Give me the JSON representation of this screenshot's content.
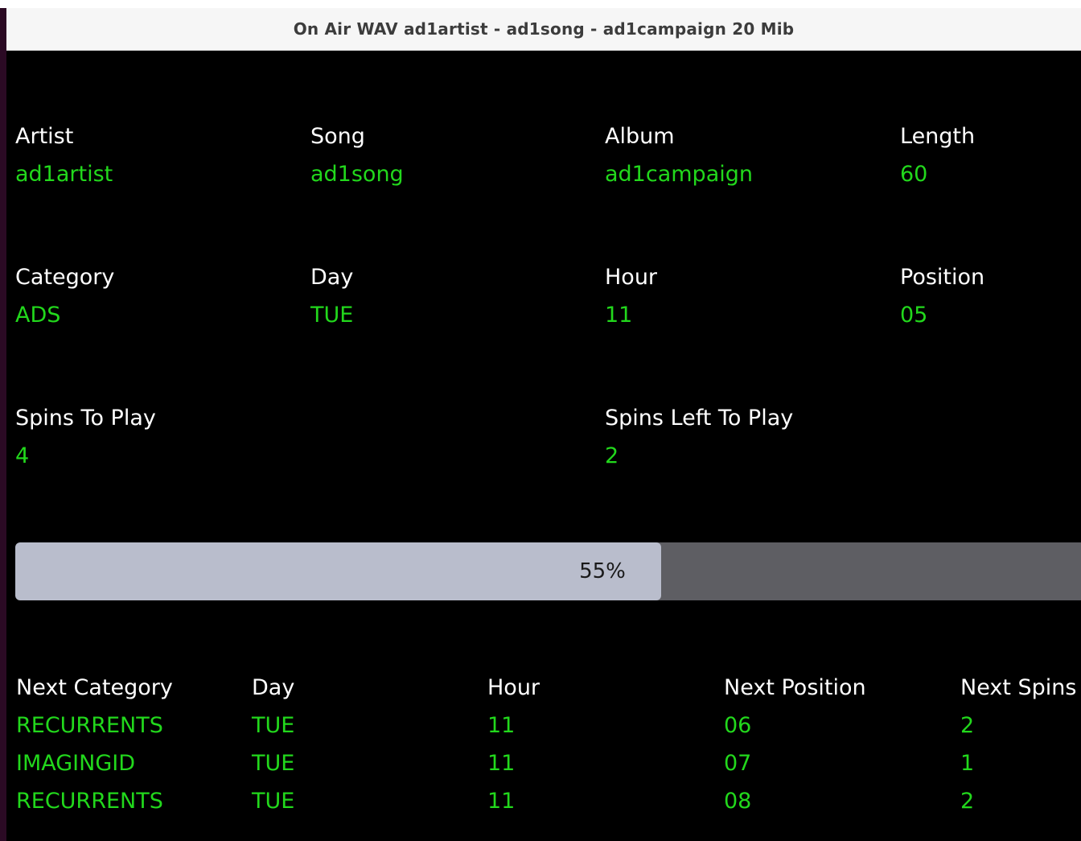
{
  "window": {
    "title": "On Air WAV ad1artist - ad1song - ad1campaign 20 Mib"
  },
  "now_playing": {
    "artist": {
      "label": "Artist",
      "value": "ad1artist"
    },
    "song": {
      "label": "Song",
      "value": "ad1song"
    },
    "album": {
      "label": "Album",
      "value": "ad1campaign"
    },
    "length": {
      "label": "Length",
      "value": "60"
    },
    "category": {
      "label": "Category",
      "value": "ADS"
    },
    "day": {
      "label": "Day",
      "value": "TUE"
    },
    "hour": {
      "label": "Hour",
      "value": "11"
    },
    "position": {
      "label": "Position",
      "value": "05"
    },
    "spins_to_play": {
      "label": "Spins To Play",
      "value": "4"
    },
    "spins_left": {
      "label": "Spins Left To Play",
      "value": "2"
    }
  },
  "progress": {
    "percent": 55,
    "text": "55%"
  },
  "next_table": {
    "headers": [
      "Next Category",
      "Day",
      "Hour",
      "Next Position",
      "Next Spins"
    ],
    "rows": [
      [
        "RECURRENTS",
        "TUE",
        "11",
        "06",
        "2"
      ],
      [
        "IMAGINGID",
        "TUE",
        "11",
        "07",
        "1"
      ],
      [
        "RECURRENTS",
        "TUE",
        "11",
        "08",
        "2"
      ]
    ]
  },
  "colors": {
    "background": "#000000",
    "label": "#ffffff",
    "value": "#22d81c",
    "progress_fill": "#b9bdcc",
    "progress_track": "#5e5e63"
  }
}
